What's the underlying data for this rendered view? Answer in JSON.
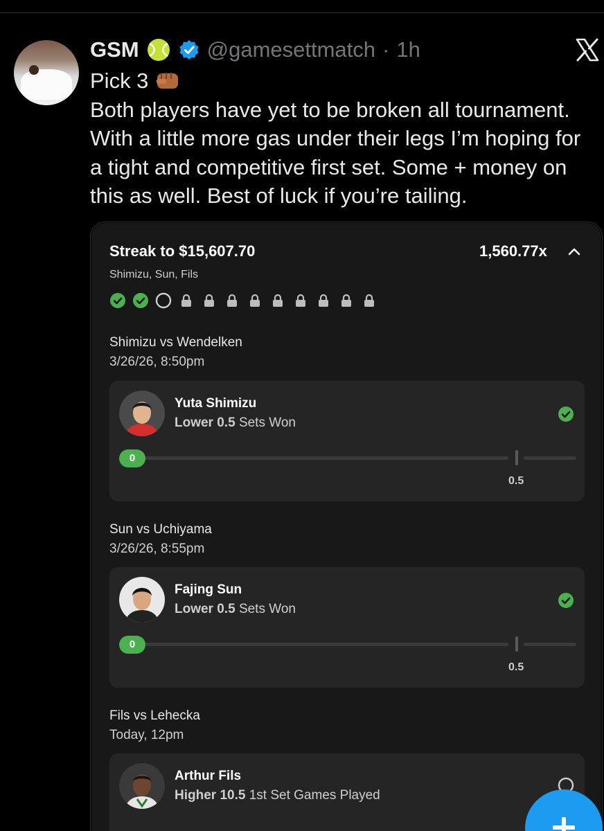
{
  "tweet": {
    "author_name": "GSM",
    "handle": "@gamesettmatch",
    "separator": "·",
    "time": "1h",
    "text_line1": "Pick 3",
    "text_lines": [
      "Both players have yet to be broken all tournament.",
      "With a little more gas under their legs I’m hoping for",
      "a tight and competitive first set. Some + money on",
      "this as well. Best of luck if you’re tailing."
    ]
  },
  "streak": {
    "title": "Streak to $15,607.70",
    "multiplier": "1,560.77x",
    "players": "Shimizu, Sun, Fils",
    "progress": [
      "won",
      "won",
      "pending",
      "locked",
      "locked",
      "locked",
      "locked",
      "locked",
      "locked",
      "locked",
      "locked",
      "locked"
    ]
  },
  "matches": [
    {
      "title": "Shimizu vs Wendelken",
      "date": "3/26/26, 8:50pm",
      "player": "Yuta Shimizu",
      "direction_line": "Lower 0.5",
      "stat": "Sets Won",
      "current": "0",
      "target": "0.5",
      "status": "won"
    },
    {
      "title": "Sun vs Uchiyama",
      "date": "3/26/26, 8:55pm",
      "player": "Fajing Sun",
      "direction_line": "Lower 0.5",
      "stat": "Sets Won",
      "current": "0",
      "target": "0.5",
      "status": "won"
    },
    {
      "title": "Fils vs Lehecka",
      "date": "Today, 12pm",
      "player": "Arthur Fils",
      "direction_line": "Higher 10.5",
      "stat": "1st Set Games Played",
      "status": "pending"
    }
  ],
  "colors": {
    "success": "#4caf50",
    "accent": "#1d9bf0",
    "background": "#000000",
    "card": "#181818"
  },
  "icons": {
    "ball": "tennis-ball-icon",
    "verified": "verified-badge-icon",
    "logo": "x-logo-icon",
    "chevron": "chevron-up-icon",
    "fab": "plus-icon"
  }
}
